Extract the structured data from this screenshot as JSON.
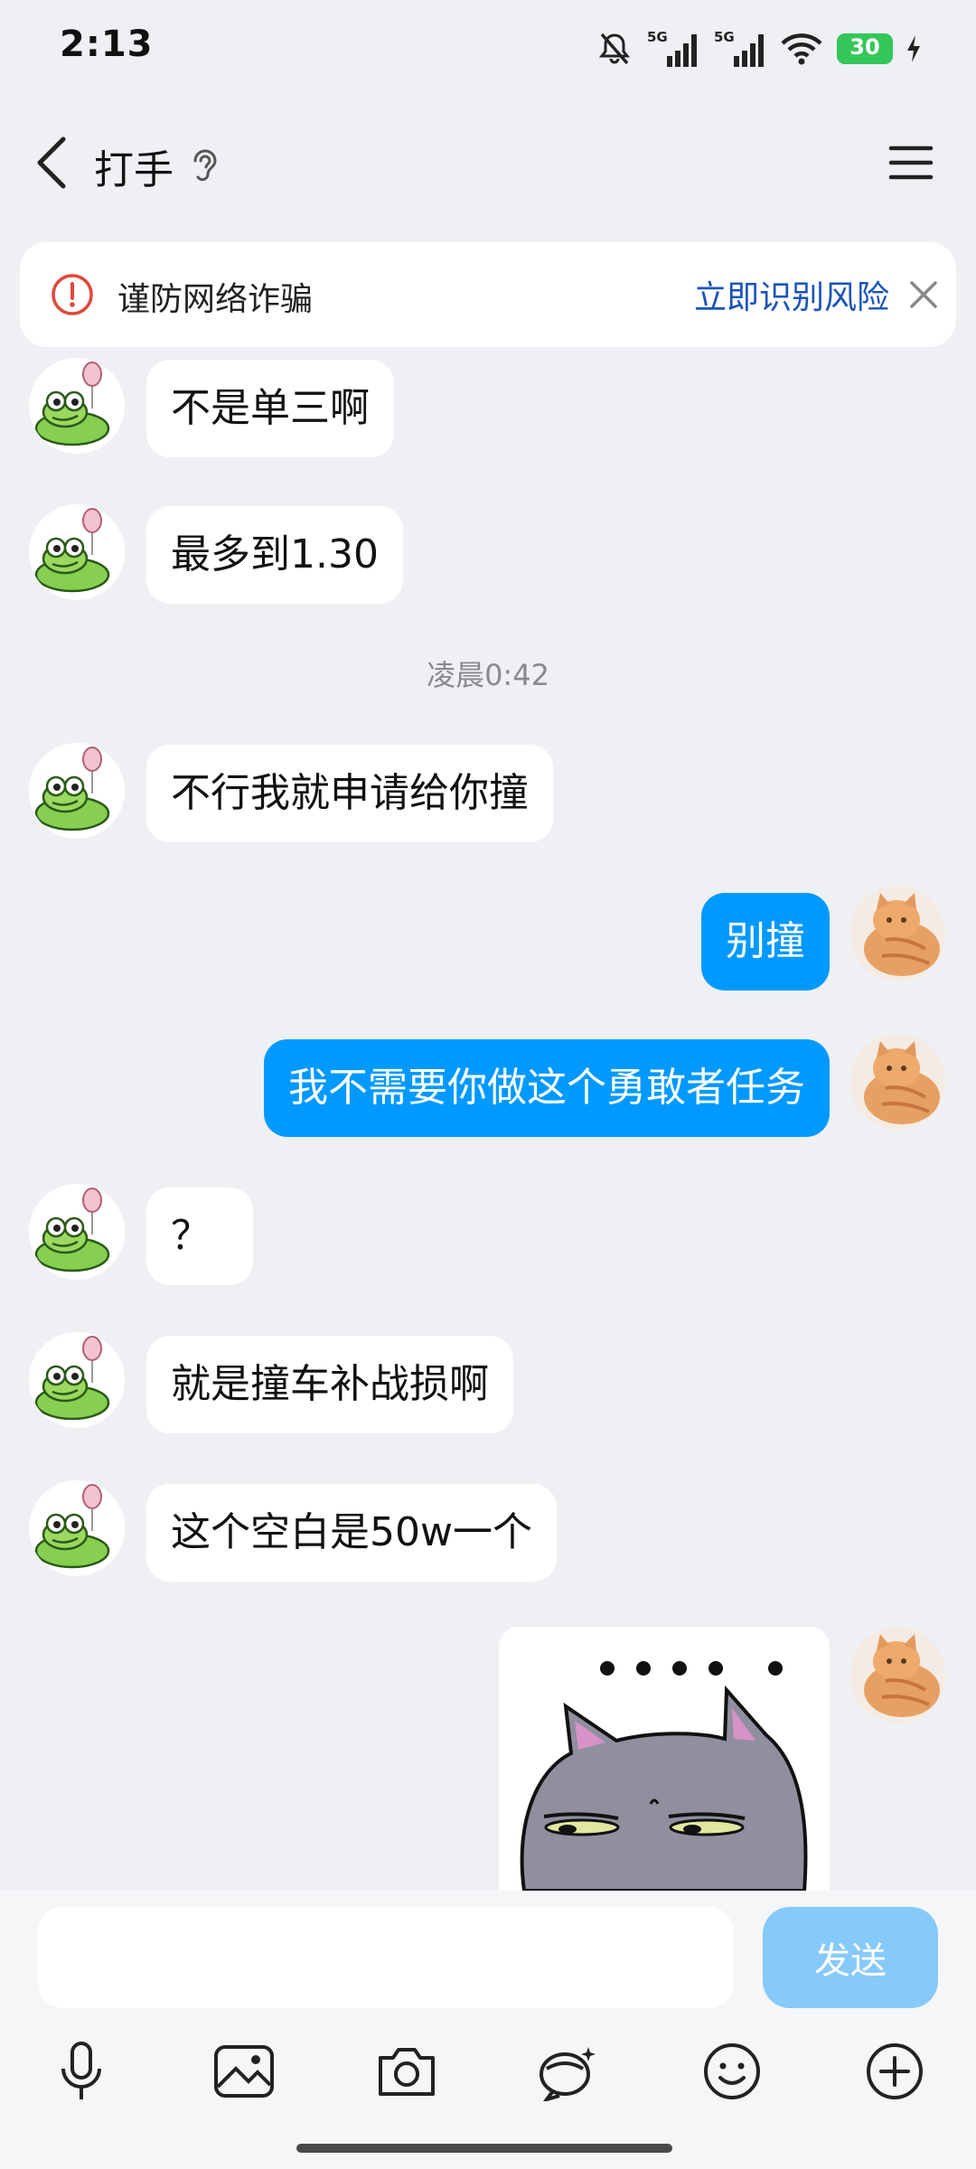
{
  "status_bar": {
    "time": "2:13",
    "battery": "30",
    "signal_1": "5G",
    "signal_2": "5G"
  },
  "header": {
    "title": "打手"
  },
  "banner": {
    "text": "谨防网络诈骗",
    "link": "立即识别风险"
  },
  "timestamp": "凌晨0:42",
  "messages": [
    {
      "side": "in",
      "text": "不是单三啊"
    },
    {
      "side": "in",
      "text": "最多到1.30"
    },
    {
      "side": "in",
      "text": "不行我就申请给你撞"
    },
    {
      "side": "out",
      "text": "别撞"
    },
    {
      "side": "out",
      "text": "我不需要你做这个勇敢者任务"
    },
    {
      "side": "in",
      "text": "？"
    },
    {
      "side": "in",
      "text": "就是撞车补战损啊"
    },
    {
      "side": "in",
      "text": "这个空白是50w一个"
    }
  ],
  "input": {
    "placeholder": "",
    "send_label": "发送"
  },
  "toolbar": [
    "mic-icon",
    "image-icon",
    "camera-icon",
    "bubble-icon",
    "emoji-icon",
    "plus-icon"
  ],
  "colors": {
    "accent": "#0099ff",
    "background": "#eff0f4",
    "send_disabled": "#86caf9",
    "link": "#1b54b8"
  }
}
